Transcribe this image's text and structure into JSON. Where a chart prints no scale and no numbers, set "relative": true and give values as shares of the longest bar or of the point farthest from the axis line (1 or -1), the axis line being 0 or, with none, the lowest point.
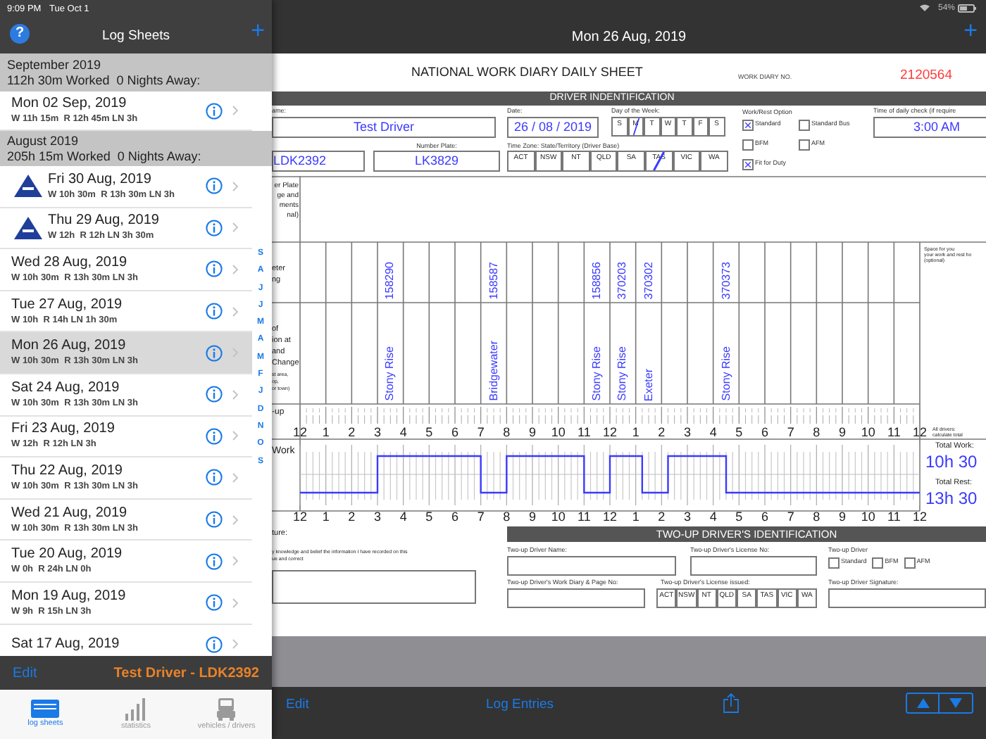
{
  "sidebar": {
    "status_time": "9:09 PM",
    "status_date": "Tue Oct 1",
    "help_button": "?",
    "title": "Log Sheets",
    "add_button": "+",
    "sections": [
      {
        "title": "September 2019",
        "totals": "112h 30m Worked  0 Nights Away:",
        "rows": [
          {
            "date": "Mon 02 Sep, 2019",
            "summary": "W 11h 15m  R 12h 45m LN 3h",
            "warning": false,
            "selected": false
          }
        ]
      },
      {
        "title": "August 2019",
        "totals": "205h 15m Worked  0 Nights Away:",
        "rows": [
          {
            "date": "Fri 30 Aug, 2019",
            "summary": "W 10h 30m  R 13h 30m LN 3h",
            "warning": true,
            "selected": false
          },
          {
            "date": "Thu 29 Aug, 2019",
            "summary": "W 12h  R 12h LN 3h 30m",
            "warning": true,
            "selected": false
          },
          {
            "date": "Wed 28 Aug, 2019",
            "summary": "W 10h 30m  R 13h 30m LN 3h",
            "warning": false,
            "selected": false
          },
          {
            "date": "Tue 27 Aug, 2019",
            "summary": "W 10h  R 14h LN 1h 30m",
            "warning": false,
            "selected": false
          },
          {
            "date": "Mon 26 Aug, 2019",
            "summary": "W 10h 30m  R 13h 30m LN 3h",
            "warning": false,
            "selected": true
          },
          {
            "date": "Sat 24 Aug, 2019",
            "summary": "W 10h 30m  R 13h 30m LN 3h",
            "warning": false,
            "selected": false
          },
          {
            "date": "Fri 23 Aug, 2019",
            "summary": "W 12h  R 12h LN 3h",
            "warning": false,
            "selected": false
          },
          {
            "date": "Thu 22 Aug, 2019",
            "summary": "W 10h 30m  R 13h 30m LN 3h",
            "warning": false,
            "selected": false
          },
          {
            "date": "Wed 21 Aug, 2019",
            "summary": "W 10h 30m  R 13h 30m LN 3h",
            "warning": false,
            "selected": false
          },
          {
            "date": "Tue 20 Aug, 2019",
            "summary": "W 0h  R 24h LN 0h",
            "warning": false,
            "selected": false
          },
          {
            "date": "Mon 19 Aug, 2019",
            "summary": "W 9h  R 15h LN 3h",
            "warning": false,
            "selected": false
          },
          {
            "date": "Sat 17 Aug, 2019",
            "warning": false,
            "selected": false
          }
        ]
      }
    ],
    "index": [
      "S",
      "A",
      "J",
      "J",
      "M",
      "A",
      "M",
      "F",
      "J",
      "D",
      "N",
      "O",
      "S"
    ],
    "edit": "Edit",
    "driver": "Test Driver - LDK2392",
    "tabs": [
      {
        "label": "log sheets",
        "kind": "sheets",
        "selected": true
      },
      {
        "label": "statistics",
        "kind": "stats",
        "selected": false
      },
      {
        "label": "vehicles / drivers",
        "kind": "vehicles",
        "selected": false
      }
    ]
  },
  "header": {
    "battery": "54%",
    "title": "Mon 26 Aug, 2019",
    "add_button": "+"
  },
  "sheet": {
    "title": "NATIONAL WORK DIARY DAILY SHEET",
    "diary_no_label": "WORK DIARY NO.",
    "diary_no": "2120564",
    "section": "DRIVER INDENTIFICATION",
    "name_label": "ame:",
    "name": "Test Driver",
    "date_label": "Date:",
    "date": "26 / 08 / 2019",
    "dow_label": "Day of the Week:",
    "days": [
      {
        "label": "S",
        "selected": false
      },
      {
        "label": "M",
        "selected": true
      },
      {
        "label": "T",
        "selected": false
      },
      {
        "label": "W",
        "selected": false
      },
      {
        "label": "T",
        "selected": false
      },
      {
        "label": "F",
        "selected": false
      },
      {
        "label": "S",
        "selected": false
      }
    ],
    "option_label": "Work/Rest Option",
    "options": [
      {
        "label": "Standard",
        "checked": true
      },
      {
        "label": "Standard Bus",
        "checked": false
      },
      {
        "label": "BFM",
        "checked": false
      },
      {
        "label": "AFM",
        "checked": false
      },
      {
        "label": "Fit for Duty",
        "checked": true
      }
    ],
    "check_label": "Time of daily check (if require",
    "check_time": "3:00 AM",
    "plate": "LDK2392",
    "number_plate_label": "Number Plate:",
    "number_plate": "LK3829",
    "tz_label": "Time Zone: State/Territory (Driver Base)",
    "states": [
      {
        "label": "ACT",
        "selected": false
      },
      {
        "label": "NSW",
        "selected": false
      },
      {
        "label": "NT",
        "selected": false
      },
      {
        "label": "QLD",
        "selected": false
      },
      {
        "label": "SA",
        "selected": false
      },
      {
        "label": "TAS",
        "selected": true
      },
      {
        "label": "VIC",
        "selected": false
      },
      {
        "label": "WA",
        "selected": false
      }
    ],
    "grid": {
      "plate_label": "er Plate\nge and\nments\nnal)",
      "odometer_label": "eter\nng",
      "location_label": "of\nion at\nand\nChange",
      "location_note": "st area,\nop,\nor town)",
      "twoup_label": "-up",
      "note": "Space for you\nyour work and rest ho\n(optional)",
      "columns": [
        {},
        {},
        {},
        {
          "odometer": "158290",
          "location": "Stony Rise"
        },
        {},
        {},
        {},
        {
          "odometer": "158587",
          "location": "Bridgewater"
        },
        {},
        {},
        {},
        {
          "odometer": "158856",
          "location": "Stony Rise"
        },
        {
          "odometer": "370203",
          "location": "Stony Rise"
        },
        {
          "odometer": "370302",
          "location": "Exeter"
        },
        {},
        {},
        {
          "odometer": "370373",
          "location": "Stony Rise"
        },
        {},
        {},
        {},
        {},
        {},
        {},
        {}
      ],
      "hours": [
        "12",
        "1",
        "2",
        "3",
        "4",
        "5",
        "6",
        "7",
        "8",
        "9",
        "10",
        "11",
        "12",
        "1",
        "2",
        "3",
        "4",
        "5",
        "6",
        "7",
        "8",
        "9",
        "10",
        "11",
        "12"
      ],
      "hours_bottom_start": "12",
      "hours_bottom_rest": [
        "12",
        "1",
        "2",
        "3",
        "4",
        "5",
        "6",
        "7",
        "8",
        "9",
        "10",
        "11",
        "12"
      ],
      "chart_data": {
        "type": "line",
        "relative": true,
        "grid": true,
        "xlim": [
          0,
          24
        ],
        "ref_lines": [
          {
            "axis": "y",
            "value": 0.5,
            "color": "#bbbbbb"
          }
        ],
        "xticks": [
          1,
          2,
          3,
          4,
          5,
          6,
          7,
          8,
          9,
          10,
          11
        ],
        "annotations": [
          "Work"
        ],
        "x": [
          0,
          3,
          3,
          7,
          7,
          8,
          8,
          11,
          11,
          12,
          12,
          13.25,
          13.25,
          14.25,
          14.25,
          16.5,
          16.5,
          24
        ],
        "series": [
          {
            "color": "#3a3aff",
            "values": [
              0,
              0,
              1,
              1,
              0,
              0,
              1,
              1,
              0,
              0,
              1,
              1,
              0,
              0,
              1,
              1,
              0,
              0
            ]
          }
        ]
      },
      "totals_note": "All drivers:\ncalculate total",
      "total_work_label": "Total Work:",
      "total_work": "10h 30",
      "total_rest_label": "Total Rest:",
      "total_rest": "13h 30"
    },
    "signature_label": "ture:",
    "declaration": "y knowledge and belief the information I have recorded on this\nue and correct",
    "twoup": {
      "section": "TWO-UP DRIVER'S IDENTIFICATION",
      "name_label": "Two-up Driver Name:",
      "license_label": "Two-up Driver's License No:",
      "option_label": "Two-up Driver",
      "options": [
        {
          "label": "Standard",
          "checked": false
        },
        {
          "label": "BFM",
          "checked": false
        },
        {
          "label": "AFM",
          "checked": false
        }
      ],
      "diary_label": "Two-up Driver's Work Diary & Page No:",
      "issued_label": "Two-up Driver's License issued:",
      "states": [
        "ACT",
        "NSW",
        "NT",
        "QLD",
        "SA",
        "TAS",
        "VIC",
        "WA"
      ],
      "signature_label": "Two-up Driver Signature:"
    }
  },
  "toolbar": {
    "edit": "Edit",
    "log_entries": "Log Entries"
  }
}
